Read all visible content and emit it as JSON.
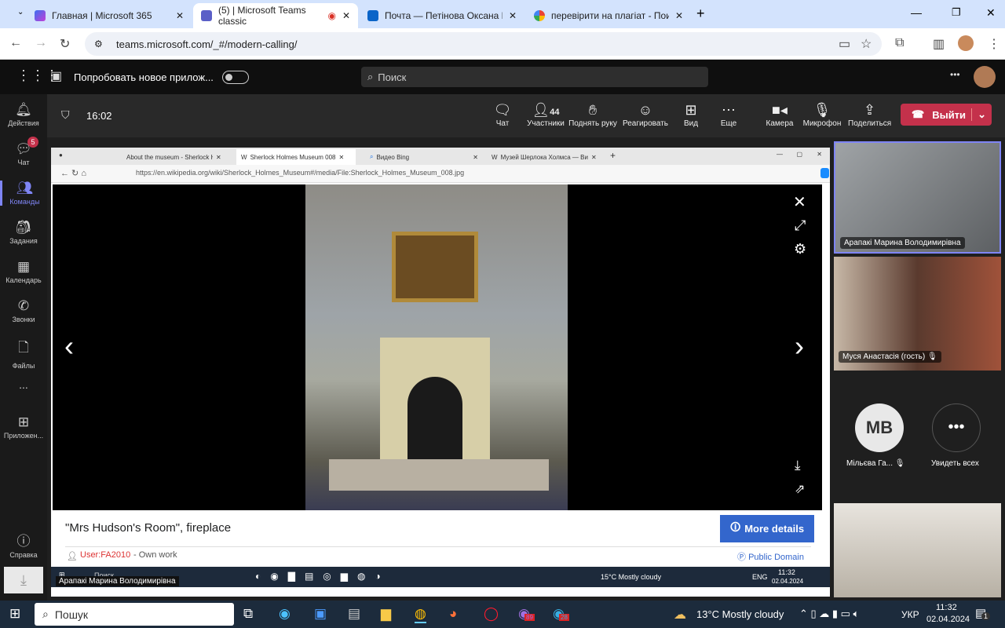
{
  "browser": {
    "tabs": [
      {
        "title": "Главная | Microsoft 365",
        "icon": "m365-icon"
      },
      {
        "title": "(5) | Microsoft Teams classic",
        "icon": "teams-icon",
        "active": true
      },
      {
        "title": "Почта — Петінова Оксана Бор",
        "icon": "outlook-icon"
      },
      {
        "title": "перевірити на плагіат - Поиск",
        "icon": "google-icon"
      }
    ],
    "url": "teams.microsoft.com/_#/modern-calling/"
  },
  "teams": {
    "promo": "Попробовать новое прилож...",
    "search_placeholder": "Поиск",
    "rail": [
      {
        "label": "Действия",
        "icon": "bell-icon"
      },
      {
        "label": "Чат",
        "icon": "chat-icon",
        "badge": "5"
      },
      {
        "label": "Команды",
        "icon": "teams-icon",
        "active": true
      },
      {
        "label": "Задания",
        "icon": "assignments-icon"
      },
      {
        "label": "Календарь",
        "icon": "calendar-icon"
      },
      {
        "label": "Звонки",
        "icon": "phone-icon"
      },
      {
        "label": "Файлы",
        "icon": "file-icon"
      },
      {
        "label": "...",
        "icon": "more-icon"
      },
      {
        "label": "Приложен...",
        "icon": "apps-icon"
      }
    ],
    "help": "Справка",
    "meeting": {
      "time": "16:02",
      "participants_count": "44",
      "buttons": [
        "Чат",
        "Участники",
        "Поднять руку",
        "Реагировать",
        "Вид",
        "Еще",
        "Камера",
        "Микрофон",
        "Поделиться"
      ],
      "leave": "Выйти"
    },
    "participants": [
      {
        "name": "Арапакі Марина Володимирівна"
      },
      {
        "name": "Муся Анастасія (гость)"
      },
      {
        "name": "Мільєва Га...",
        "initials": "MB"
      },
      {
        "name": "Увидеть всех"
      }
    ]
  },
  "shared": {
    "tabs": [
      "About the museum - Sherlock H",
      "Sherlock Holmes Museum 008",
      "Видео Bing",
      "Музей Шерлока Холмса — Ви"
    ],
    "url": "https://en.wikipedia.org/wiki/Sherlock_Holmes_Museum#/media/File:Sherlock_Holmes_Museum_008.jpg",
    "caption": "\"Mrs Hudson's Room\", fireplace",
    "more_details": "More details",
    "author": "User:FA2010",
    "author_suffix": " - Own work",
    "license": "Public Domain",
    "taskbar": {
      "search": "Поиск",
      "presenter": "Арапакі Марина Володимирівна",
      "weather": "15°C  Mostly cloudy",
      "lang": "ENG",
      "time": "11:32",
      "date": "02.04.2024"
    }
  },
  "taskbar": {
    "search": "Пошук",
    "weather": "13°C  Mostly cloudy",
    "lang": "УКР",
    "time": "11:32",
    "date": "02.04.2024",
    "viber_badge": "89",
    "telegram_badge": "28",
    "notif_badge": "1"
  },
  "colors": {
    "accent": "#7f85f5",
    "leave": "#c4314b",
    "more_details": "#3366cc"
  }
}
